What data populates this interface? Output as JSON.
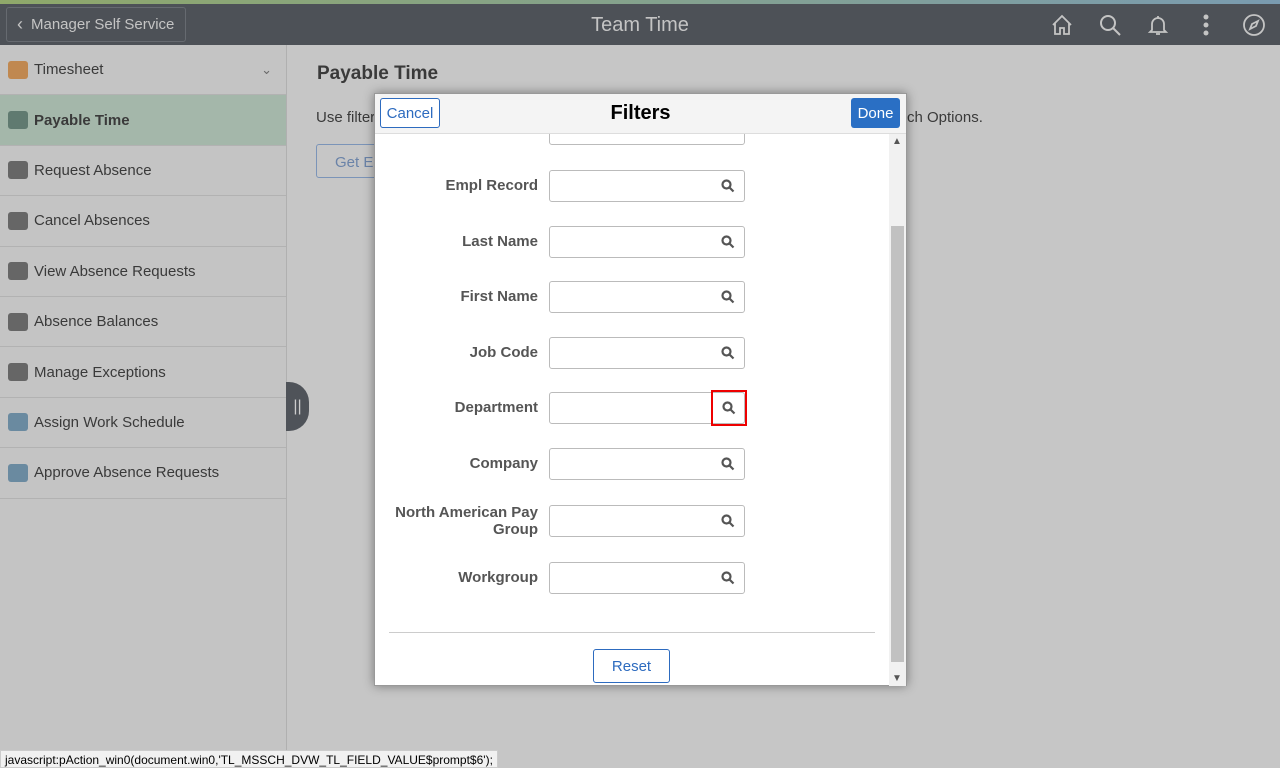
{
  "header": {
    "back_label": "Manager Self Service",
    "title": "Team Time",
    "icons": [
      "home-icon",
      "search-icon",
      "bell-icon",
      "more-vertical-icon",
      "compass-icon"
    ]
  },
  "sidebar": {
    "items": [
      {
        "label": "Timesheet",
        "icon": "timesheet-icon",
        "expandable": true
      },
      {
        "label": "Payable Time",
        "icon": "clock-money-icon",
        "active": true
      },
      {
        "label": "Request Absence",
        "icon": "briefcase-icon"
      },
      {
        "label": "Cancel Absences",
        "icon": "briefcase-cancel-icon"
      },
      {
        "label": "View Absence Requests",
        "icon": "briefcase-calendar-icon"
      },
      {
        "label": "Absence Balances",
        "icon": "briefcase-balance-icon"
      },
      {
        "label": "Manage Exceptions",
        "icon": "clock-exception-icon"
      },
      {
        "label": "Assign Work Schedule",
        "icon": "schedule-icon"
      },
      {
        "label": "Approve Absence Requests",
        "icon": "schedule-approve-icon"
      }
    ]
  },
  "main": {
    "title": "Payable Time",
    "desc_left": "Use filter",
    "desc_right": "rch Options.",
    "get_button": "Get E"
  },
  "modal": {
    "title": "Filters",
    "cancel": "Cancel",
    "done": "Done",
    "reset": "Reset",
    "fields": [
      {
        "label": "Empl Record",
        "value": ""
      },
      {
        "label": "Last Name",
        "value": ""
      },
      {
        "label": "First Name",
        "value": ""
      },
      {
        "label": "Job Code",
        "value": ""
      },
      {
        "label": "Department",
        "value": "",
        "highlighted": true
      },
      {
        "label": "Company",
        "value": ""
      },
      {
        "label": "North American Pay Group",
        "value": ""
      },
      {
        "label": "Workgroup",
        "value": ""
      }
    ]
  },
  "status_bar": "javascript:pAction_win0(document.win0,'TL_MSSCH_DVW_TL_FIELD_VALUE$prompt$6');",
  "colors": {
    "header": "#4d5157",
    "active_item": "#a4b7aa",
    "primary": "#2a6fc4",
    "highlight": "#e00000"
  }
}
